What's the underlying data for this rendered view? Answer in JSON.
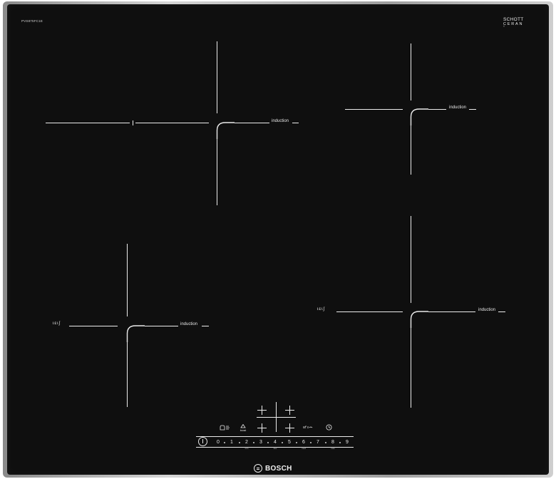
{
  "panel": {
    "model_code": "PVS875FC1E",
    "schott_logo": {
      "line1": "SCHOTT",
      "line2": "CERAN",
      "line3": "®"
    },
    "brand": "BOSCH"
  },
  "zones": [
    {
      "id": "front-left-zone",
      "label": "induction",
      "flex_marker": ""
    },
    {
      "id": "rear-right-zone",
      "label": "induction",
      "flex_marker": ""
    },
    {
      "id": "rear-left-zone",
      "label": "induction",
      "flex_marker": "ɩ ɛ ɩ ʃ"
    },
    {
      "id": "front-right-zone",
      "label": "induction",
      "flex_marker": "ɩ ɛ ɩ ʃ"
    }
  ],
  "controls": {
    "power_label": "I",
    "pan_detection_icon": "pan-detection-icon",
    "boost_label": "boost",
    "flexinduction_icon": "flex-icon",
    "timer_icon": "clock-icon"
  },
  "slider": {
    "numbers": [
      "0",
      "1",
      "2",
      "3",
      "4",
      "5",
      "6",
      "7",
      "8",
      "9"
    ],
    "sub_labels": [
      "min",
      "low",
      "med",
      "max"
    ]
  },
  "colors": {
    "glass": "#0f0f0f",
    "markings": "#ececec",
    "frame": "#c0c0c0"
  }
}
